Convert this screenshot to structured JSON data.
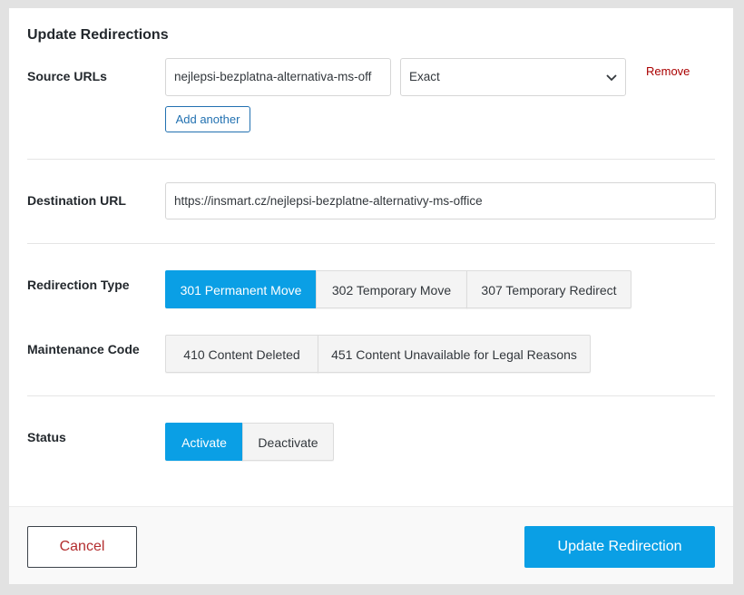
{
  "modal": {
    "title": "Update Redirections"
  },
  "source": {
    "label": "Source URLs",
    "url_value": "nejlepsi-bezplatna-alternativa-ms-off",
    "match_type": "Exact",
    "remove_label": "Remove",
    "add_another_label": "Add another"
  },
  "destination": {
    "label": "Destination URL",
    "value": "https://insmart.cz/nejlepsi-bezplatne-alternativy-ms-office"
  },
  "redirection_type": {
    "label": "Redirection Type",
    "options": [
      "301 Permanent Move",
      "302 Temporary Move",
      "307 Temporary Redirect"
    ],
    "selected": "301 Permanent Move"
  },
  "maintenance_code": {
    "label": "Maintenance Code",
    "options": [
      "410 Content Deleted",
      "451 Content Unavailable for Legal Reasons"
    ]
  },
  "status": {
    "label": "Status",
    "options": [
      "Activate",
      "Deactivate"
    ],
    "selected": "Activate"
  },
  "footer": {
    "cancel_label": "Cancel",
    "update_label": "Update Redirection"
  },
  "colors": {
    "accent": "#0a9fe5",
    "danger": "#b32d2e",
    "link": "#2271b1"
  },
  "icons": {
    "select_chevron": "chevron-down-icon"
  }
}
